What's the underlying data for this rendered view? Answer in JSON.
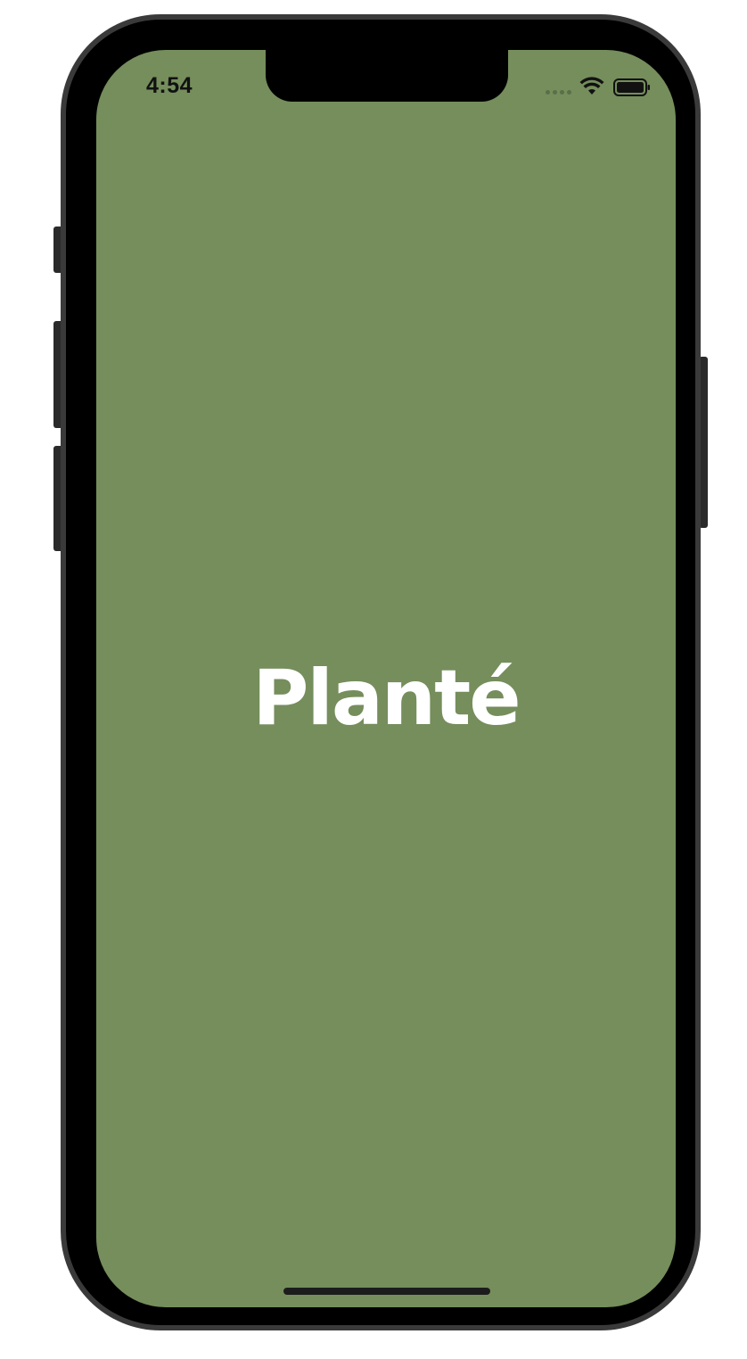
{
  "status_bar": {
    "time": "4:54",
    "icons": [
      "cellular-signal-icon",
      "wifi-icon",
      "battery-icon"
    ]
  },
  "splash": {
    "app_name": "Planté"
  },
  "colors": {
    "background": "#758e5c",
    "title_text": "#ffffff",
    "frame": "#000000"
  }
}
